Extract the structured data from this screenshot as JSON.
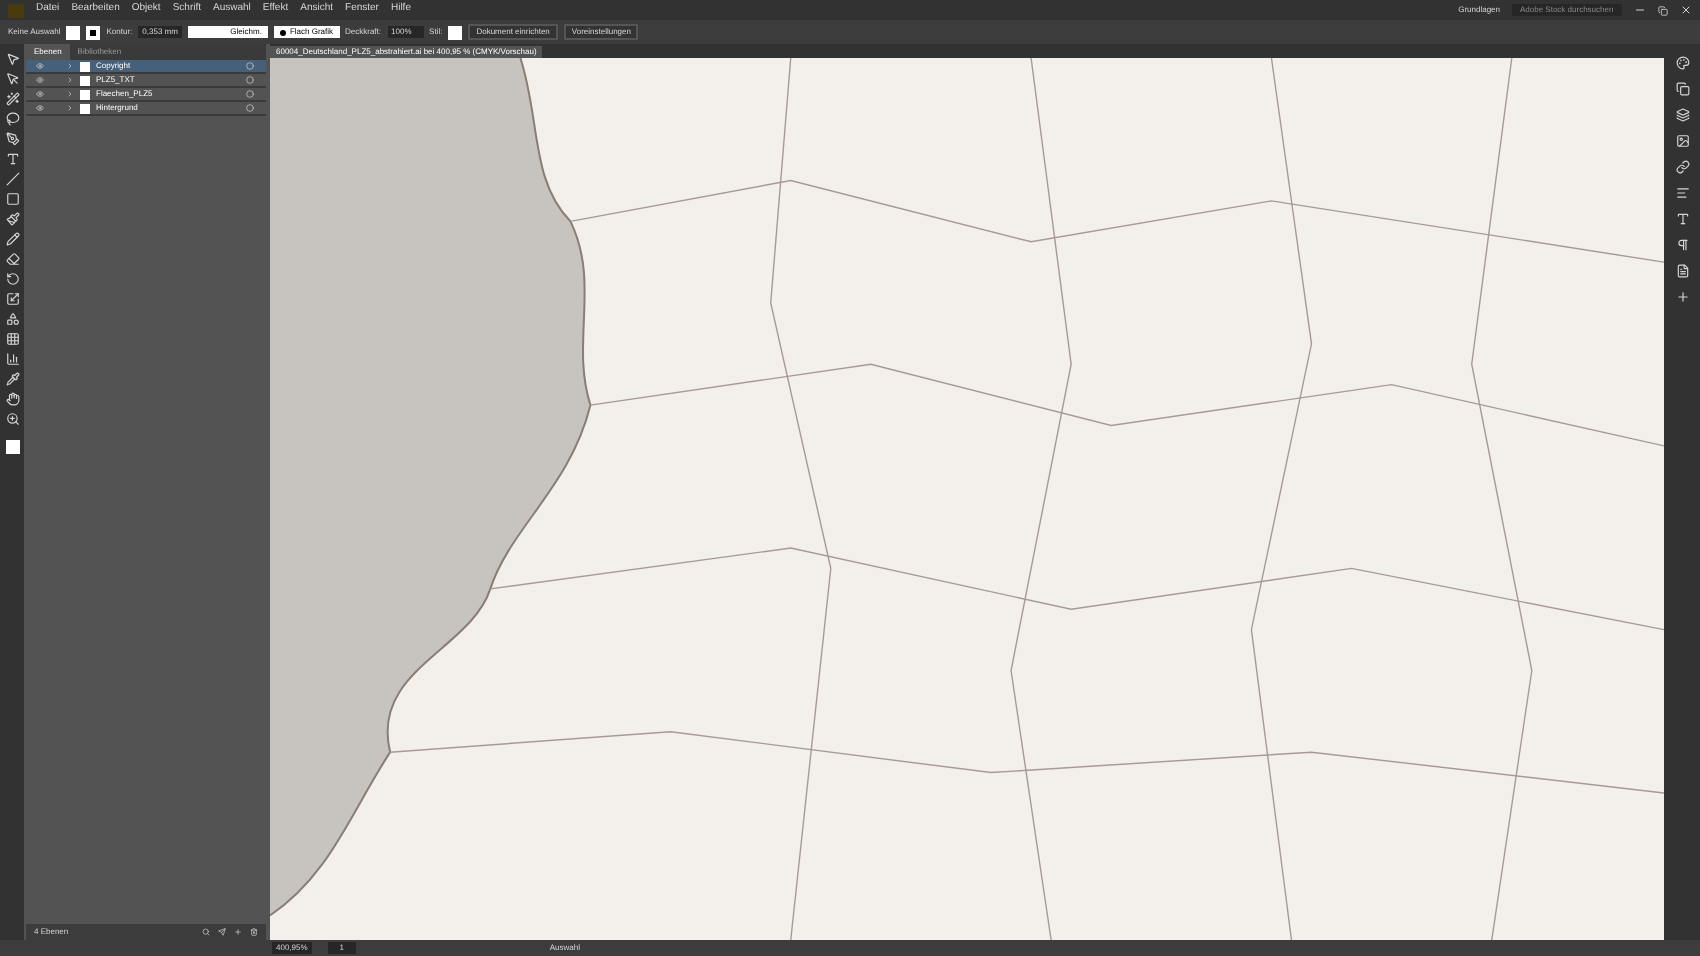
{
  "menu": [
    "Datei",
    "Bearbeiten",
    "Objekt",
    "Schrift",
    "Auswahl",
    "Effekt",
    "Ansicht",
    "Fenster",
    "Hilfe"
  ],
  "workspace": "Grundlagen",
  "search": {
    "placeholder": "Adobe Stock durchsuchen"
  },
  "control_bar": {
    "selection": "Keine Auswahl",
    "stroke_label": "Kontur:",
    "stroke_value": "0,353 mm",
    "stroke_profile": "Gleichm.",
    "brush": "Flach Grafik",
    "opacity_label": "Deckkraft:",
    "opacity_value": "100%",
    "style_label": "Stil:",
    "buttons": [
      "Dokument einrichten",
      "Voreinstellungen"
    ]
  },
  "document_tab": {
    "title": "60004_Deutschland_PLZ5_abstrahiert.ai bei 400,95 % (CMYK/Vorschau)"
  },
  "panel": {
    "tabs": [
      {
        "label": "Ebenen",
        "selected": true
      },
      {
        "label": "Bibliotheken",
        "selected": false
      }
    ],
    "layers": [
      {
        "name": "Copyright",
        "selected": true
      },
      {
        "name": "PLZ5_TXT",
        "selected": false
      },
      {
        "name": "Flaechen_PLZ5",
        "selected": false
      },
      {
        "name": "Hintergrund",
        "selected": false
      }
    ],
    "footer": "4 Ebenen"
  },
  "status_bar": {
    "zoom": "400,95%",
    "artboard": "1",
    "tool": "Auswahl"
  }
}
